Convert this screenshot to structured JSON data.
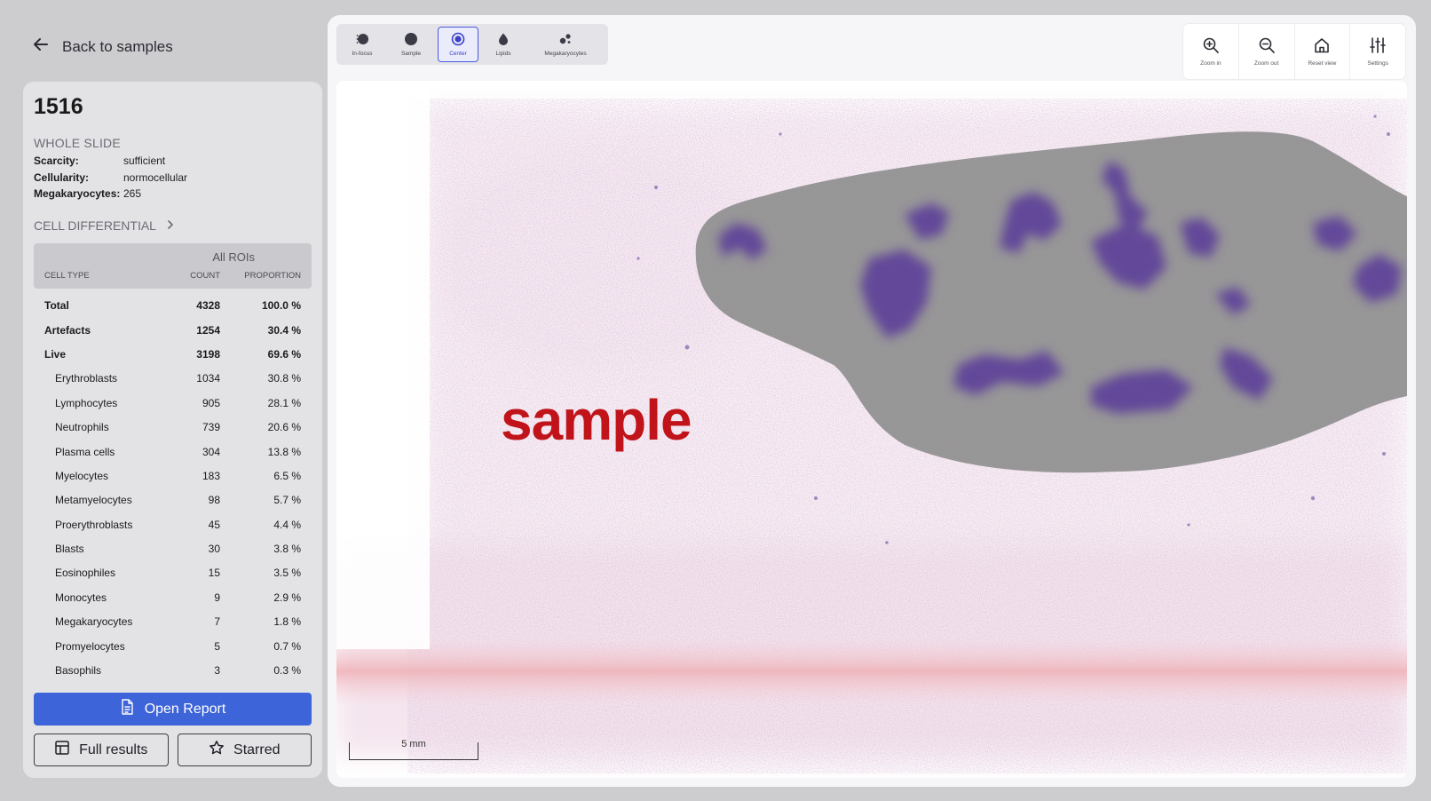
{
  "nav": {
    "back_label": "Back to samples"
  },
  "slide": {
    "id": "1516",
    "section_label": "WHOLE SLIDE",
    "properties": [
      {
        "key": "Scarcity:",
        "value": "sufficient"
      },
      {
        "key": "Cellularity:",
        "value": "normocellular"
      },
      {
        "key": "Megakaryocytes:",
        "value": "265"
      }
    ]
  },
  "cell_differential": {
    "heading": "CELL DIFFERENTIAL",
    "group_label": "All ROIs",
    "columns": {
      "type": "CELL TYPE",
      "count": "COUNT",
      "proportion": "PROPORTION"
    },
    "rows": [
      {
        "type": "Total",
        "count": "4328",
        "proportion": "100.0 %",
        "bold": true
      },
      {
        "type": "Artefacts",
        "count": "1254",
        "proportion": "30.4 %",
        "bold": true
      },
      {
        "type": "Live",
        "count": "3198",
        "proportion": "69.6 %",
        "bold": true
      },
      {
        "type": "Erythroblasts",
        "count": "1034",
        "proportion": "30.8 %"
      },
      {
        "type": "Lymphocytes",
        "count": "905",
        "proportion": "28.1 %"
      },
      {
        "type": "Neutrophils",
        "count": "739",
        "proportion": "20.6 %"
      },
      {
        "type": "Plasma cells",
        "count": "304",
        "proportion": "13.8 %"
      },
      {
        "type": "Myelocytes",
        "count": "183",
        "proportion": "6.5 %"
      },
      {
        "type": "Metamyelocytes",
        "count": "98",
        "proportion": "5.7 %"
      },
      {
        "type": "Proerythroblasts",
        "count": "45",
        "proportion": "4.4 %"
      },
      {
        "type": "Blasts",
        "count": "30",
        "proportion": "3.8 %"
      },
      {
        "type": "Eosinophiles",
        "count": "15",
        "proportion": "3.5 %"
      },
      {
        "type": "Monocytes",
        "count": "9",
        "proportion": "2.9 %"
      },
      {
        "type": "Megakaryocytes",
        "count": "7",
        "proportion": "1.8 %"
      },
      {
        "type": "Promyelocytes",
        "count": "5",
        "proportion": "0.7 %"
      },
      {
        "type": "Basophils",
        "count": "3",
        "proportion": "0.3 %"
      }
    ]
  },
  "actions": {
    "open_report": "Open Report",
    "full_results": "Full results",
    "starred": "Starred"
  },
  "layer_tools": [
    {
      "id": "in-focus",
      "label": "In-focus",
      "icon": "in-focus-icon",
      "active": false
    },
    {
      "id": "sample",
      "label": "Sample",
      "icon": "sample-dot-icon",
      "active": false
    },
    {
      "id": "center",
      "label": "Center",
      "icon": "center-target-icon",
      "active": true
    },
    {
      "id": "lipids",
      "label": "Lipids",
      "icon": "lipid-drop-icon",
      "active": false
    },
    {
      "id": "megakaryocytes",
      "label": "Megakaryocytes",
      "icon": "cells-cluster-icon",
      "active": false
    }
  ],
  "view_tools": [
    {
      "id": "zoom-in",
      "label": "Zoom in",
      "icon": "zoom-in-icon"
    },
    {
      "id": "zoom-out",
      "label": "Zoom out",
      "icon": "zoom-out-icon"
    },
    {
      "id": "reset-view",
      "label": "Reset view",
      "icon": "home-icon"
    },
    {
      "id": "settings",
      "label": "Settings",
      "icon": "sliders-icon"
    }
  ],
  "viewer": {
    "scale_label": "5 mm",
    "watermark": "sample"
  },
  "colors": {
    "accent": "#3d64d8",
    "active_tool": "#4b5ae0",
    "stain_purple": "#5a3a9a",
    "roi_overlay": "#8f8f8f",
    "watermark": "#c0141a"
  }
}
